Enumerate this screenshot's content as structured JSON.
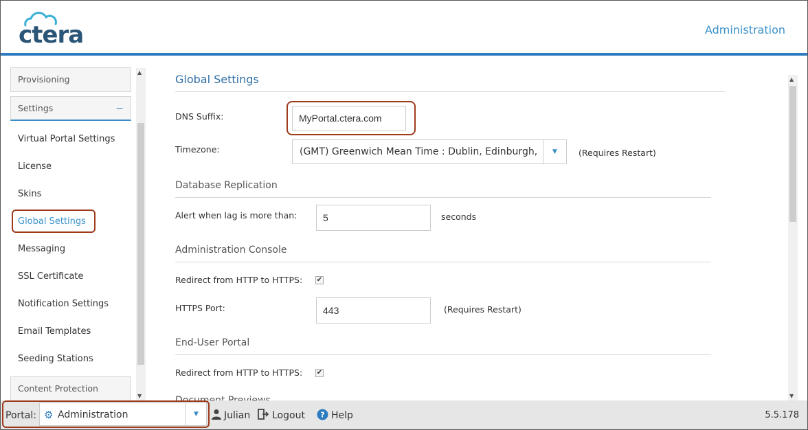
{
  "header": {
    "logo_text": "ctera",
    "title": "Administration"
  },
  "sidebar": {
    "sections": {
      "provisioning": "Provisioning",
      "settings": "Settings",
      "settings_toggle": "−",
      "content_protection": "Content Protection"
    },
    "items": [
      {
        "label": "Virtual Portal Settings"
      },
      {
        "label": "License"
      },
      {
        "label": "Skins"
      },
      {
        "label": "Global Settings"
      },
      {
        "label": "Messaging"
      },
      {
        "label": "SSL Certificate"
      },
      {
        "label": "Notification Settings"
      },
      {
        "label": "Email Templates"
      },
      {
        "label": "Seeding Stations"
      }
    ],
    "active_item": "Global Settings"
  },
  "main": {
    "title": "Global Settings",
    "dns_suffix": {
      "label": "DNS Suffix:",
      "value": "MyPortal.ctera.com"
    },
    "timezone": {
      "label": "Timezone:",
      "value": "(GMT) Greenwich Mean Time : Dublin, Edinburgh, Lisbon, London",
      "note": "(Requires Restart)"
    },
    "database_replication": {
      "title": "Database Replication",
      "alert_label": "Alert when lag is more than:",
      "alert_value": "5",
      "unit": "seconds"
    },
    "administration_console": {
      "title": "Administration Console",
      "redirect_label": "Redirect from HTTP to HTTPS:",
      "redirect_checked": true,
      "https_port_label": "HTTPS Port:",
      "https_port_value": "443",
      "https_port_note": "(Requires Restart)"
    },
    "end_user_portal": {
      "title": "End-User Portal",
      "redirect_label": "Redirect from HTTP to HTTPS:",
      "redirect_checked": true
    },
    "partial_section": "Document Previews",
    "check_glyph": "✔"
  },
  "footer": {
    "portal_label": "Portal:",
    "portal_value": "Administration",
    "user": "Julian",
    "logout": "Logout",
    "help": "Help",
    "version": "5.5.178"
  },
  "icons": {
    "portal": "gear-icon",
    "user": "user-icon",
    "logout": "logout-icon",
    "help": "help-icon",
    "dropdown": "chevron-down-icon"
  },
  "colors": {
    "accent": "#2d7cc1",
    "link": "#3a91c9",
    "highlight": "#9c3a1a",
    "footer_bg": "#e6e6e6"
  }
}
